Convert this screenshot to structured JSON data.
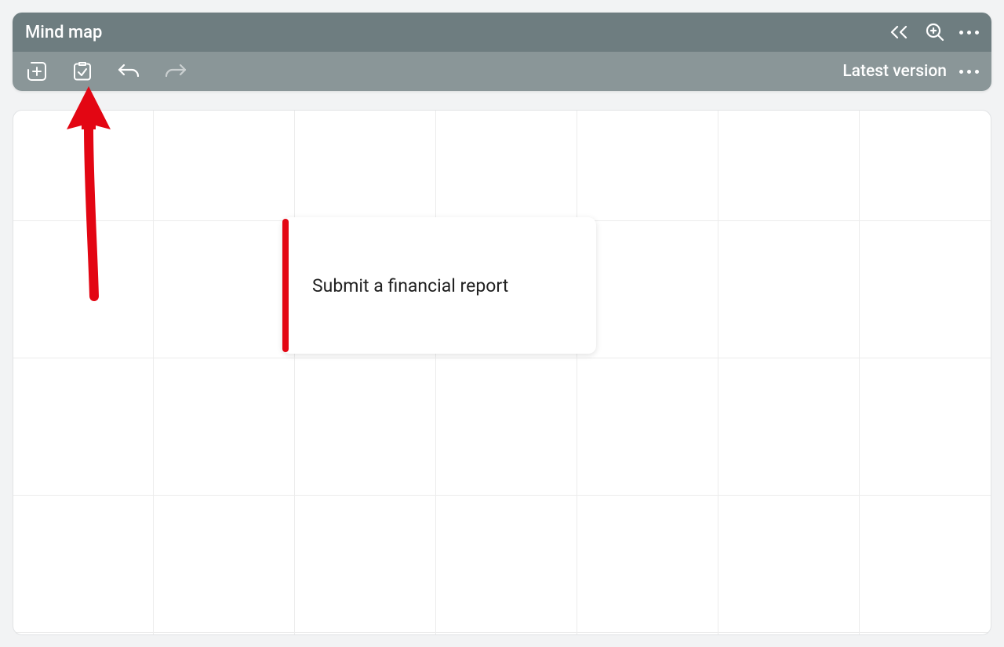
{
  "header": {
    "title": "Mind map"
  },
  "toolbar": {
    "version_label": "Latest version"
  },
  "canvas": {
    "node": {
      "text": "Submit a financial report",
      "accent_color": "#e30613"
    }
  },
  "annotation": {
    "arrow_color": "#e30613"
  }
}
